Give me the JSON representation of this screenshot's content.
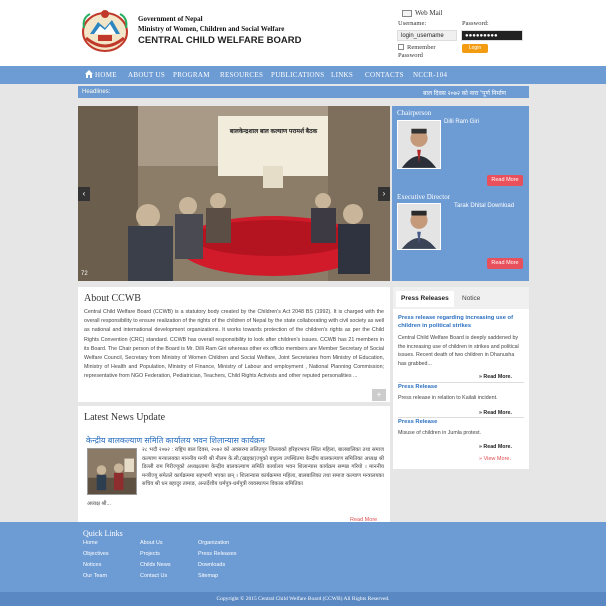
{
  "header": {
    "gov_line1": "Government of Nepal",
    "gov_line2": "Ministry of Women, Children and Social Welfare",
    "board_name": "CENTRAL CHILD WELFARE BOARD",
    "webmail_label": "Web Mail",
    "username_label": "Username:",
    "password_label": "Password:",
    "username_value": "login_username",
    "password_value": "●●●●●●●●●",
    "remember_label": "Remember",
    "remember_label2": "Password",
    "login_label": "Login"
  },
  "nav": {
    "items": [
      "HOME",
      "ABOUT US",
      "PROGRAM",
      "RESOURCES",
      "PUBLICATIONS",
      "LINKS",
      "CONTACTS",
      "NCCR-104"
    ]
  },
  "headlines": {
    "label": "Headlines:",
    "ticker": "बाल दिवस २०७२ को नारा \"पूर्ण निर्माण"
  },
  "slider": {
    "banner_text": "बालकेन्द्रशाल बाल कल्याण परामर्श बैठक",
    "slide_number": "72",
    "prev_symbol": "‹",
    "next_symbol": "›"
  },
  "chairperson": {
    "title": "Chairperson",
    "name": "Dilli Ram Giri",
    "read_more": "Read More"
  },
  "executive": {
    "title": "Executive Director",
    "name": "Tarak Dhital  Download",
    "read_more": "Read More"
  },
  "about": {
    "title": "About CCWB",
    "text": "Central Child Welfare Board (CCWB) is a statutory body created by the Children's Act 2048 BS (1992). It is charged with the overall responsibility to ensure realization of the rights of the children of Nepal by the state collaborating with civil society as well as national and international development organizations. It works towards protection of the children's rights as per the Child Rights Convention (CRC) standard. CCWB has overall responsibility to look after children's issues. CCWB has 21 members in its Board. The Chair person of the Board is Mr. Dilli Ram Giri  whereas other ex officio members are Member Secretary of Social Welfare Council, Secretary from Ministry of Women Children and Social Welfare, Joint Secretaries from Ministry of Education, Ministry of Health and Population, Ministry of Finance, Ministry of Labour and employment , National Planning Commission; representative from NGO Federation, Pediatrician, Teachers, Child Rights Activists and other reputed personalities ...",
    "plus_symbol": "+"
  },
  "news": {
    "title": "Latest News Update",
    "item_title": "केन्द्रीय बालकल्याण समिति कार्यालय भवन शिलान्यास कार्यक्रम",
    "item_text": "२८ भदौ २०७२ : राष्ट्रिय बाल दिवस, २०७२ को अवसरमा ललितपुर जिल्लाको हरिहरभवन स्थित महिला, बालबालिका तथा समाज कल्याण मन्त्रालयका माननीय मन्त्री श्री नीलम के.सी.(खड्का)ज्यूको बाहुल्य उपस्थितमा केन्द्रीय बालकल्याण समितिका अध्यक्ष श्री डिल्ली राम गिरीज्यूको अध्यक्षतामा केन्द्रीय बालकल्याण समिति कार्यालय भवन शिलान्यास कार्यक्रम सम्पन्न गरियो । माननीय मन्त्रीज्यू समेतले कार्यक्रममा सहभागी भएका छन् । शिलान्यास कार्यक्रममा महिला, बालबालिका तथा समाज कल्याण मन्त्रालयका सचिव श्री धन बहादुर तामाङ, अन्तर्देशीय धर्मपुत्र-धर्मपुत्री व्यवस्थापन विकास समितिका",
    "item_more": "अध्यक्ष श्री...",
    "read_more": "Read More"
  },
  "press": {
    "tab_active": "Press Releases",
    "tab_inactive": "Notice",
    "items": [
      {
        "title": "Press release regarding increasing use of children in political strikes",
        "text": "Central Child Welfare Board is deeply saddened by the increasing use of children in strikes and political issues. Recent death of two children in Dhanusha has grabbed...",
        "more": "» Read More."
      },
      {
        "title": "Press Release",
        "text": "Press release in relation to Kailali incident.",
        "more": "» Read More."
      },
      {
        "title": "Press Release",
        "text": "Misuse of children in Jumla protest.",
        "more": "» Read More."
      }
    ],
    "view_more": "» View More."
  },
  "footer": {
    "title": "Quick Links",
    "col1": [
      "Home",
      "Objectives",
      "Notices",
      "Our Team"
    ],
    "col2": [
      "About Us",
      "Projects",
      "Childs News",
      "Contact Us"
    ],
    "col3": [
      "Organization",
      "Press Releases",
      "Downloads",
      "Sitemap"
    ],
    "copyright": "Copyright © 2015 Central Child Welfare Board (CCWB) All Rights Reserved."
  },
  "colors": {
    "nav_blue": "#6d9bd3",
    "accent_red": "#e8505b",
    "login_orange": "#f39c12",
    "link_blue": "#2a6fc0"
  }
}
